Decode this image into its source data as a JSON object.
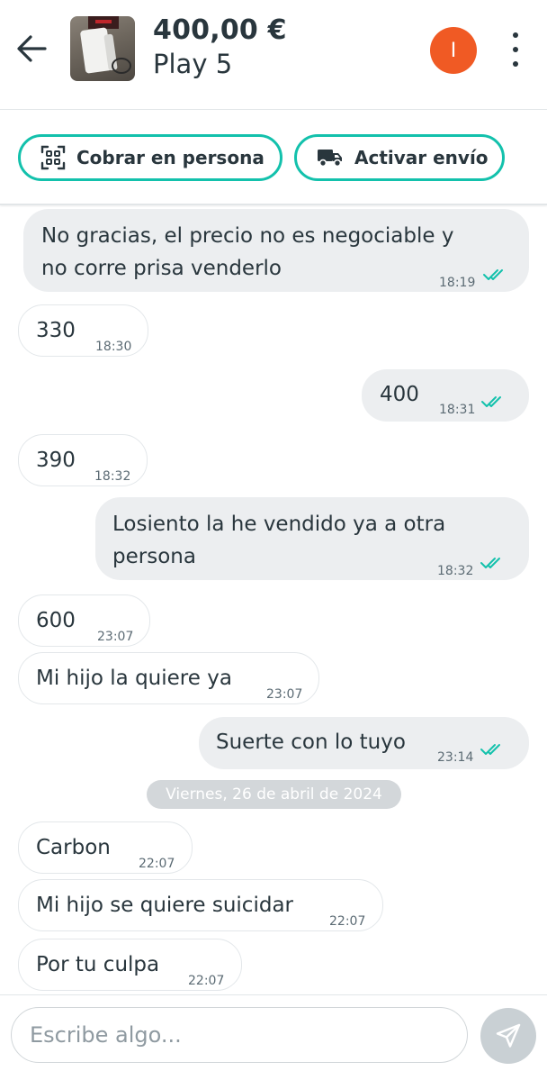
{
  "header": {
    "price": "400,00 €",
    "title": "Play 5",
    "avatar_initial": "I",
    "avatar_color": "#f05a24"
  },
  "actions": {
    "cobrar_label": "Cobrar en persona",
    "envio_label": "Activar envío",
    "accent_color": "#13c1ac"
  },
  "messages": [
    {
      "side": "out",
      "lines": [
        "No gracias, el precio no es negociable y",
        "no corre prisa venderlo"
      ],
      "time": "18:19",
      "read": true
    },
    {
      "side": "in",
      "lines": [
        "330"
      ],
      "time": "18:30"
    },
    {
      "side": "out",
      "lines": [
        "400"
      ],
      "time": "18:31",
      "read": true
    },
    {
      "side": "in",
      "lines": [
        "390"
      ],
      "time": "18:32"
    },
    {
      "side": "out",
      "lines": [
        "Losiento la he vendido ya a otra",
        "persona"
      ],
      "time": "18:32",
      "read": true
    },
    {
      "side": "in",
      "lines": [
        "600"
      ],
      "time": "23:07"
    },
    {
      "side": "in",
      "lines": [
        "Mi hijo la quiere ya"
      ],
      "time": "23:07"
    },
    {
      "side": "out",
      "lines": [
        "Suerte con lo tuyo"
      ],
      "time": "23:14",
      "read": true
    },
    {
      "side": "in",
      "lines": [
        "Carbon"
      ],
      "time": "22:07"
    },
    {
      "side": "in",
      "lines": [
        "Mi hijo se quiere suicidar"
      ],
      "time": "22:07"
    },
    {
      "side": "in",
      "lines": [
        "Por tu culpa"
      ],
      "time": "22:07"
    }
  ],
  "date_separator": "Viernes, 26 de abril de 2024",
  "composer": {
    "placeholder": "Escribe algo..."
  },
  "icons": {
    "back": "arrow-left-icon",
    "menu": "more-vertical-icon",
    "cobrar": "qr-code-icon",
    "envio": "truck-icon",
    "read": "double-check-icon",
    "send": "send-icon"
  }
}
